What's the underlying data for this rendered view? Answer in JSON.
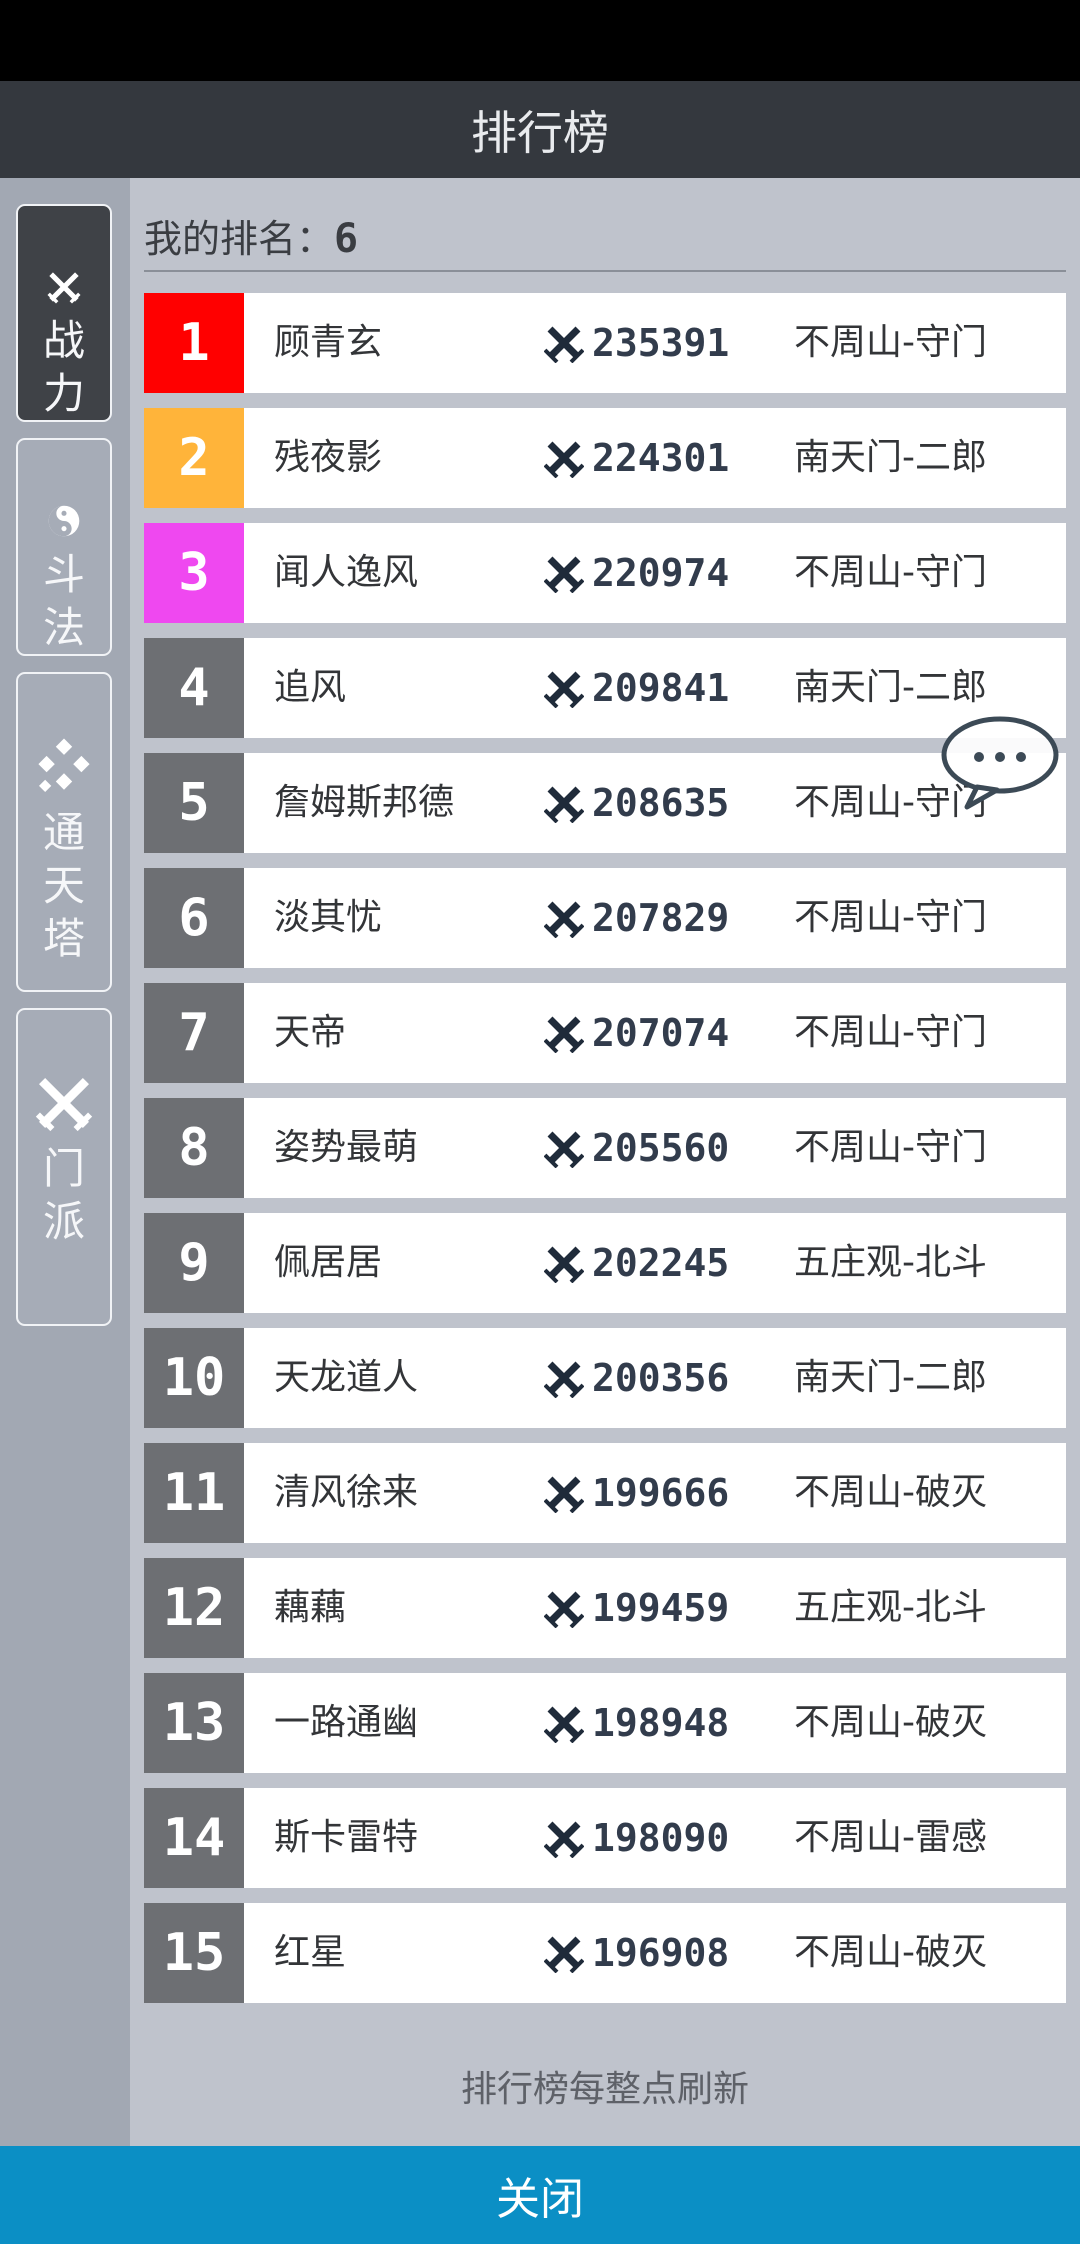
{
  "title": "排行榜",
  "sidebar": {
    "tabs": [
      {
        "label": "战力",
        "icon": "crossed-swords-icon",
        "active": true
      },
      {
        "label": "斗法",
        "icon": "yin-yang-icon",
        "active": false
      },
      {
        "label": "通天塔",
        "icon": "checkered-flag-icon",
        "active": false
      },
      {
        "label": "门派",
        "icon": "crossed-swords-icon",
        "active": false
      }
    ]
  },
  "my_rank": {
    "label": "我的排名：",
    "value": "6"
  },
  "rank_colors": {
    "1": "#ff0000",
    "2": "#ffb43a",
    "3": "#ef48f0",
    "default": "#6d6f73"
  },
  "rows": [
    {
      "rank": "1",
      "name": "顾青玄",
      "power": "235391",
      "server": "不周山-守门"
    },
    {
      "rank": "2",
      "name": "残夜影",
      "power": "224301",
      "server": "南天门-二郎"
    },
    {
      "rank": "3",
      "name": "闻人逸风",
      "power": "220974",
      "server": "不周山-守门"
    },
    {
      "rank": "4",
      "name": "追风",
      "power": "209841",
      "server": "南天门-二郎"
    },
    {
      "rank": "5",
      "name": "詹姆斯邦德",
      "power": "208635",
      "server": "不周山-守门"
    },
    {
      "rank": "6",
      "name": "淡其忧",
      "power": "207829",
      "server": "不周山-守门"
    },
    {
      "rank": "7",
      "name": "天帝",
      "power": "207074",
      "server": "不周山-守门"
    },
    {
      "rank": "8",
      "name": "姿势最萌",
      "power": "205560",
      "server": "不周山-守门"
    },
    {
      "rank": "9",
      "name": "佩居居",
      "power": "202245",
      "server": "五庄观-北斗"
    },
    {
      "rank": "10",
      "name": "天龙道人",
      "power": "200356",
      "server": "南天门-二郎"
    },
    {
      "rank": "11",
      "name": "清风徐来",
      "power": "199666",
      "server": "不周山-破灭"
    },
    {
      "rank": "12",
      "name": "藕藕",
      "power": "199459",
      "server": "五庄观-北斗"
    },
    {
      "rank": "13",
      "name": "一路通幽",
      "power": "198948",
      "server": "不周山-破灭"
    },
    {
      "rank": "14",
      "name": "斯卡雷特",
      "power": "198090",
      "server": "不周山-雷感"
    },
    {
      "rank": "15",
      "name": "红星",
      "power": "196908",
      "server": "不周山-破灭"
    }
  ],
  "footer_note": "排行榜每整点刷新",
  "close_label": "关闭"
}
